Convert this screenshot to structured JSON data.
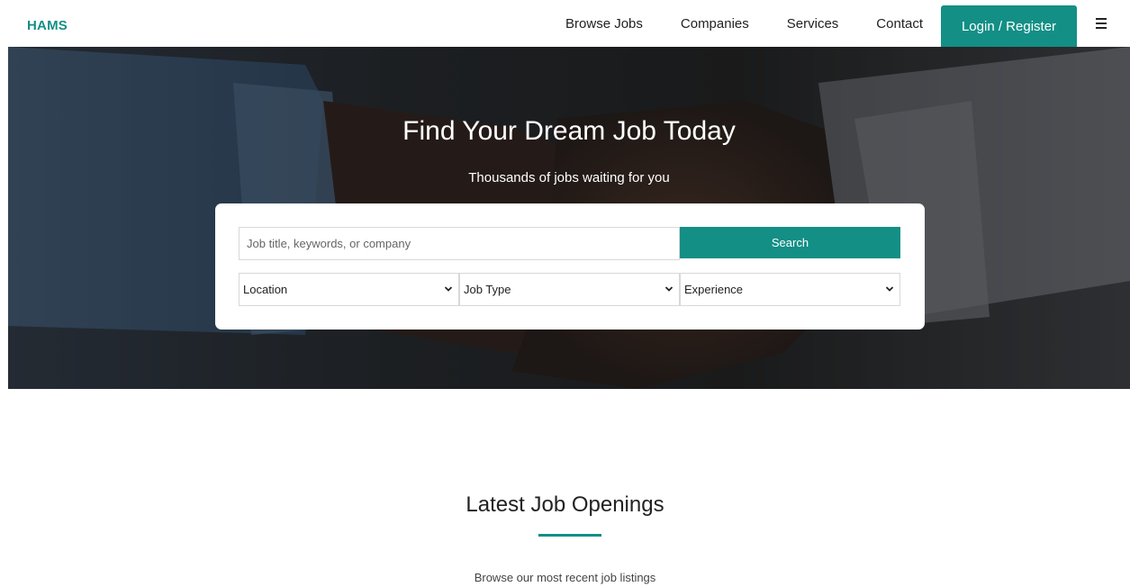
{
  "header": {
    "brand": "HAMS",
    "nav": [
      "Browse Jobs",
      "Companies",
      "Services",
      "Contact"
    ],
    "login_label": "Login / Register",
    "brand_color": "#138f86"
  },
  "hero": {
    "title": "Find Your Dream Job Today",
    "subtitle": "Thousands of jobs waiting for you",
    "background": "handshake-photo"
  },
  "search": {
    "placeholder": "Job title, keywords, or company",
    "button_label": "Search",
    "filters": {
      "location": "Location",
      "job_type": "Job Type",
      "experience": "Experience"
    }
  },
  "section": {
    "title": "Latest Job Openings",
    "subtitle": "Browse our most recent job listings"
  },
  "icons": {
    "menu": "hamburger-icon",
    "dropdown": "chevron-down-icon"
  }
}
